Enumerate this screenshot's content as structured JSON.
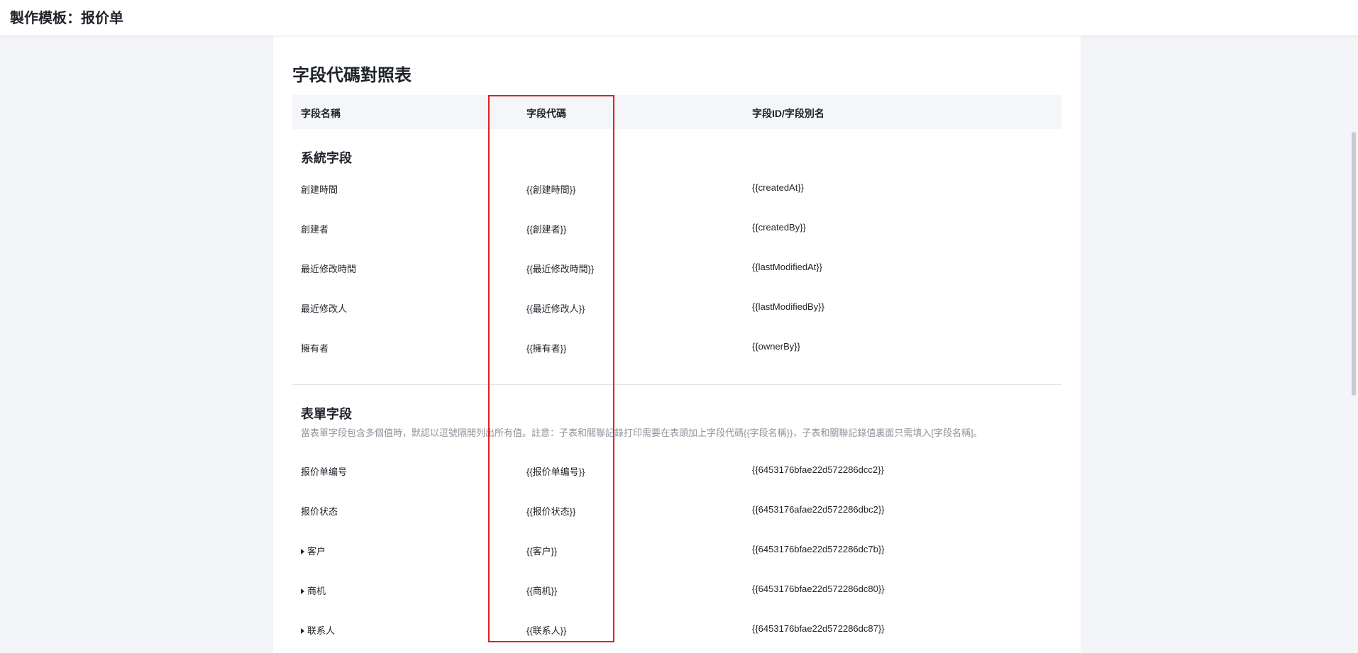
{
  "header": {
    "title": "製作模板：报价单"
  },
  "panel": {
    "title": "字段代碼對照表",
    "columns": [
      "字段名稱",
      "字段代碼",
      "字段ID/字段別名"
    ]
  },
  "system_fields": {
    "title": "系統字段",
    "rows": [
      {
        "name": "創建時間",
        "code": "{{創建時間}}",
        "id": "{{createdAt}}"
      },
      {
        "name": "創建者",
        "code": "{{創建者}}",
        "id": "{{createdBy}}"
      },
      {
        "name": "最近修改時間",
        "code": "{{最近修改時間}}",
        "id": "{{lastModifiedAt}}"
      },
      {
        "name": "最近修改人",
        "code": "{{最近修改人}}",
        "id": "{{lastModifiedBy}}"
      },
      {
        "name": "擁有者",
        "code": "{{擁有者}}",
        "id": "{{ownerBy}}"
      }
    ]
  },
  "form_fields": {
    "title": "表單字段",
    "description": "當表單字段包含多個值時，默認以逗號隔開列出所有值。註意：子表和關聯記錄打印需要在表頭加上字段代碼{{字段名稱}}，子表和關聯記錄值裏面只需填入[字段名稱]。",
    "rows": [
      {
        "name": "报价单编号",
        "code": "{{报价单编号}}",
        "id": "{{6453176bfae22d572286dcc2}}",
        "expandable": false
      },
      {
        "name": "报价状态",
        "code": "{{报价状态}}",
        "id": "{{6453176afae22d572286dbc2}}",
        "expandable": false
      },
      {
        "name": "客户",
        "code": "{{客户}}",
        "id": "{{6453176bfae22d572286dc7b}}",
        "expandable": true
      },
      {
        "name": "商机",
        "code": "{{商机}}",
        "id": "{{6453176bfae22d572286dc80}}",
        "expandable": true
      },
      {
        "name": "联系人",
        "code": "{{联系人}}",
        "id": "{{6453176bfae22d572286dc87}}",
        "expandable": true
      }
    ]
  },
  "colors": {
    "highlight": "#e02020",
    "background": "#f4f5f8",
    "header_bg": "#f5f6f9",
    "muted_text": "#8f959e"
  },
  "icons": {
    "expand": "caret-right-icon"
  }
}
